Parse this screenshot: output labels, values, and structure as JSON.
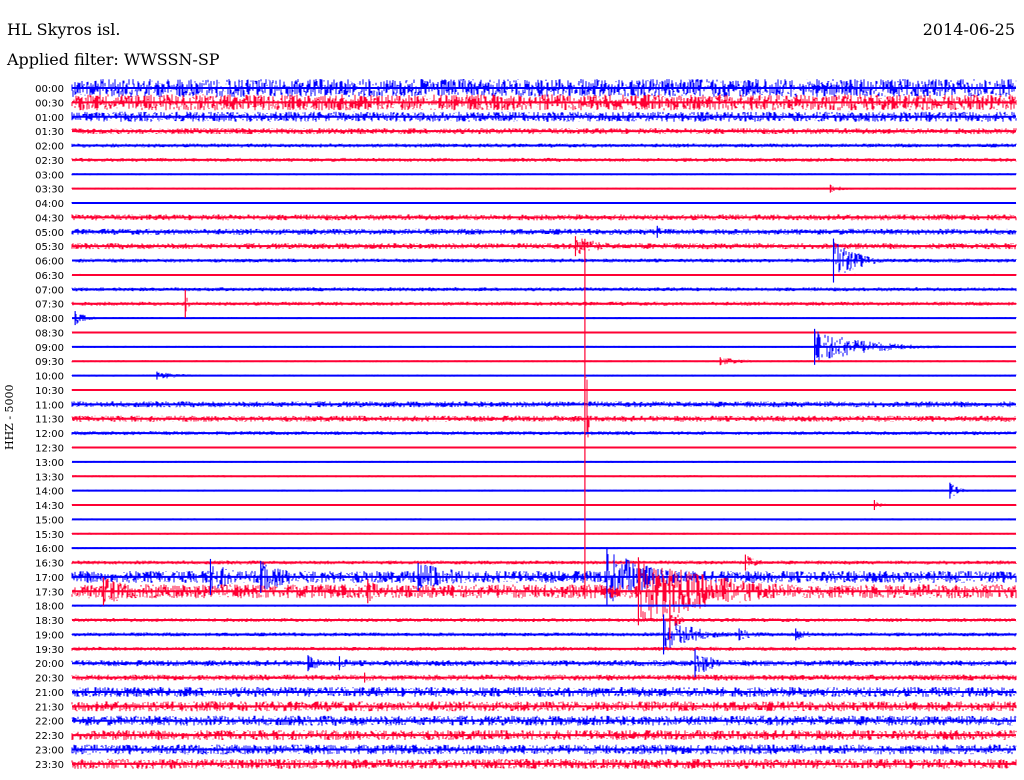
{
  "header": {
    "station": "HL Skyros isl.",
    "date": "2014-06-25",
    "filter": "Applied filter: WWSSN-SP",
    "channel": "HHZ - 5000"
  },
  "colors": {
    "blue": "#0000ff",
    "red": "#ff0033",
    "baseline": "#000000"
  },
  "chart_data": {
    "type": "line",
    "title": "HL Skyros isl.",
    "subtitle": "Applied filter: WWSSN-SP",
    "date": "2014-06-25",
    "ylabel": "HHZ - 5000",
    "xlabel": "",
    "x_range_minutes": [
      0,
      30
    ],
    "row_interval_minutes": 30,
    "row_labels": [
      "00:00",
      "00:30",
      "01:00",
      "01:30",
      "02:00",
      "02:30",
      "03:00",
      "03:30",
      "04:00",
      "04:30",
      "05:00",
      "05:30",
      "06:00",
      "06:30",
      "07:00",
      "07:30",
      "08:00",
      "08:30",
      "09:00",
      "09:30",
      "10:00",
      "10:30",
      "11:00",
      "11:30",
      "12:00",
      "12:30",
      "13:00",
      "13:30",
      "14:00",
      "14:30",
      "15:00",
      "15:30",
      "16:00",
      "16:30",
      "17:00",
      "17:30",
      "18:00",
      "18:30",
      "19:00",
      "19:30",
      "20:00",
      "20:30",
      "21:00",
      "21:30",
      "22:00",
      "22:30",
      "23:00",
      "23:30"
    ],
    "row_colors": [
      "blue",
      "red"
    ],
    "noise_levels": [
      9,
      8,
      5,
      3,
      2,
      2,
      1,
      1,
      1,
      3,
      3,
      3,
      2,
      1,
      2,
      2,
      1,
      1,
      1,
      1,
      1,
      1,
      3,
      3,
      2,
      1,
      1,
      1,
      1,
      1,
      1,
      1,
      1,
      2,
      6,
      7,
      1,
      2,
      2,
      2,
      3,
      3,
      5,
      5,
      5,
      5,
      5,
      5
    ],
    "events": [
      {
        "row": "03:30",
        "t_min": 24.1,
        "amplitude": 4,
        "duration_min": 0.8
      },
      {
        "row": "05:00",
        "t_min": 18.6,
        "amplitude": 6,
        "duration_min": 0.4
      },
      {
        "row": "05:30",
        "t_min": 16.0,
        "amplitude": 10,
        "duration_min": 1.5
      },
      {
        "row": "06:00",
        "t_min": 24.2,
        "amplitude": 22,
        "duration_min": 1.2
      },
      {
        "row": "07:30",
        "t_min": 3.6,
        "amplitude": 14,
        "duration_min": 0.1
      },
      {
        "row": "08:00",
        "t_min": 0.1,
        "amplitude": 7,
        "duration_min": 0.6
      },
      {
        "row": "09:00",
        "t_min": 23.6,
        "amplitude": 18,
        "duration_min": 2.5
      },
      {
        "row": "09:30",
        "t_min": 20.6,
        "amplitude": 4,
        "duration_min": 1.5
      },
      {
        "row": "10:00",
        "t_min": 2.7,
        "amplitude": 4,
        "duration_min": 1.5
      },
      {
        "row": "11:30",
        "t_min": 16.3,
        "amplitude": 180,
        "duration_min": 0.05
      },
      {
        "row": "14:00",
        "t_min": 27.9,
        "amplitude": 8,
        "duration_min": 0.5
      },
      {
        "row": "14:30",
        "t_min": 25.5,
        "amplitude": 5,
        "duration_min": 0.4
      },
      {
        "row": "16:30",
        "t_min": 21.4,
        "amplitude": 8,
        "duration_min": 0.7
      },
      {
        "row": "17:00",
        "t_min": 4.4,
        "amplitude": 18,
        "duration_min": 1.2
      },
      {
        "row": "17:00",
        "t_min": 6.0,
        "amplitude": 16,
        "duration_min": 1.8
      },
      {
        "row": "17:00",
        "t_min": 11.0,
        "amplitude": 14,
        "duration_min": 3.0
      },
      {
        "row": "17:00",
        "t_min": 17.0,
        "amplitude": 28,
        "duration_min": 2.5
      },
      {
        "row": "17:30",
        "t_min": 1.0,
        "amplitude": 14,
        "duration_min": 2.0
      },
      {
        "row": "17:30",
        "t_min": 9.4,
        "amplitude": 12,
        "duration_min": 1.0
      },
      {
        "row": "17:30",
        "t_min": 18.0,
        "amplitude": 34,
        "duration_min": 5.0
      },
      {
        "row": "18:30",
        "t_min": 19.0,
        "amplitude": 20,
        "duration_min": 0.3
      },
      {
        "row": "19:00",
        "t_min": 18.8,
        "amplitude": 20,
        "duration_min": 1.5
      },
      {
        "row": "19:00",
        "t_min": 21.2,
        "amplitude": 6,
        "duration_min": 1.0
      },
      {
        "row": "19:00",
        "t_min": 23.0,
        "amplitude": 6,
        "duration_min": 1.0
      },
      {
        "row": "20:00",
        "t_min": 7.5,
        "amplitude": 8,
        "duration_min": 0.8
      },
      {
        "row": "20:00",
        "t_min": 8.5,
        "amplitude": 7,
        "duration_min": 0.6
      },
      {
        "row": "20:00",
        "t_min": 19.8,
        "amplitude": 14,
        "duration_min": 1.0
      },
      {
        "row": "20:30",
        "t_min": 9.3,
        "amplitude": 5,
        "duration_min": 0.6
      }
    ]
  }
}
